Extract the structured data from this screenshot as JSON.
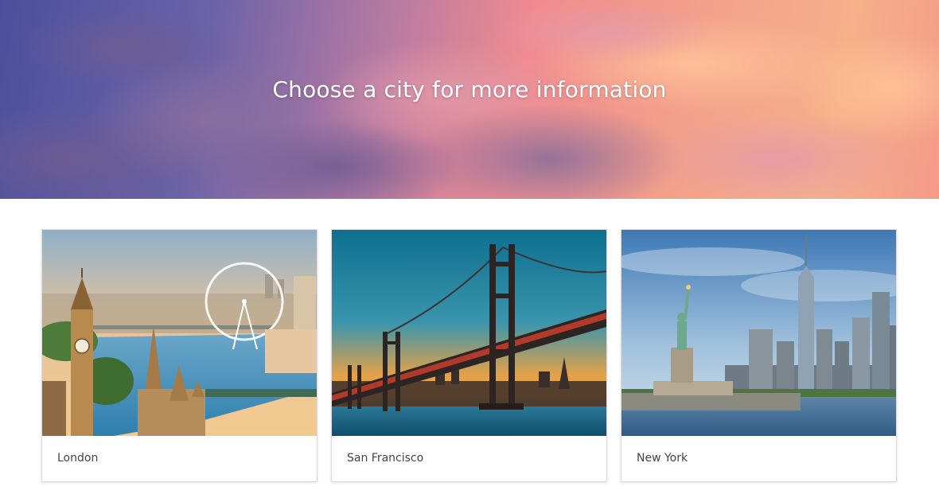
{
  "hero": {
    "title": "Choose a city for more information"
  },
  "cities": [
    {
      "name": "London",
      "image_icon": "london-skyline-image"
    },
    {
      "name": "San Francisco",
      "image_icon": "golden-gate-bridge-image"
    },
    {
      "name": "New York",
      "image_icon": "new-york-skyline-image"
    }
  ],
  "colors": {
    "hero_sky_left": "#4c4f9c",
    "hero_sky_right": "#f6b08a",
    "card_border": "#dcdcdc",
    "label_text": "#444444"
  }
}
